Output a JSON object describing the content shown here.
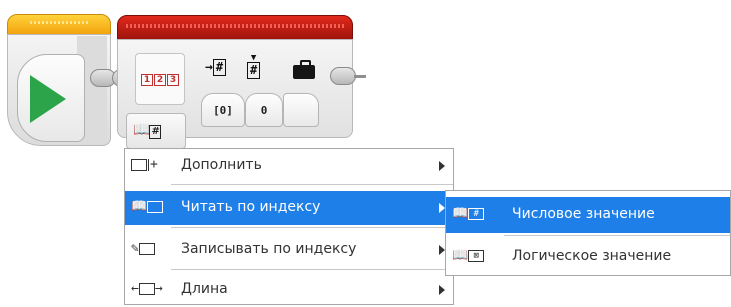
{
  "start_block": {
    "icon": "play-icon"
  },
  "array_block": {
    "mode_icon": "array-123-icon",
    "mode_digits": [
      "1",
      "2",
      "3"
    ],
    "header_icons": [
      "input-number-array-icon",
      "index-number-icon",
      "output-briefcase-icon"
    ],
    "param_array_value": "[0]",
    "param_index_value": "0",
    "mode_selector_icon": "read-at-index-numeric-icon"
  },
  "menu": {
    "items": [
      {
        "label": "Дополнить",
        "icon": "append-icon",
        "has_submenu": true,
        "selected": false
      },
      {
        "label": "Читать по индексу",
        "icon": "read-at-index-icon",
        "has_submenu": true,
        "selected": true
      },
      {
        "label": "Записывать по индексу",
        "icon": "write-at-index-icon",
        "has_submenu": true,
        "selected": false
      },
      {
        "label": "Длина",
        "icon": "length-icon",
        "has_submenu": true,
        "selected": false
      }
    ]
  },
  "submenu": {
    "items": [
      {
        "label": "Числовое значение",
        "icon": "numeric-value-icon",
        "selected": true
      },
      {
        "label": "Логическое значение",
        "icon": "logic-value-icon",
        "selected": false
      }
    ]
  },
  "colors": {
    "selection": "#1f7fe8",
    "start_header": "#f2a10b",
    "array_header": "#c41a10",
    "play": "#2ca44a"
  }
}
